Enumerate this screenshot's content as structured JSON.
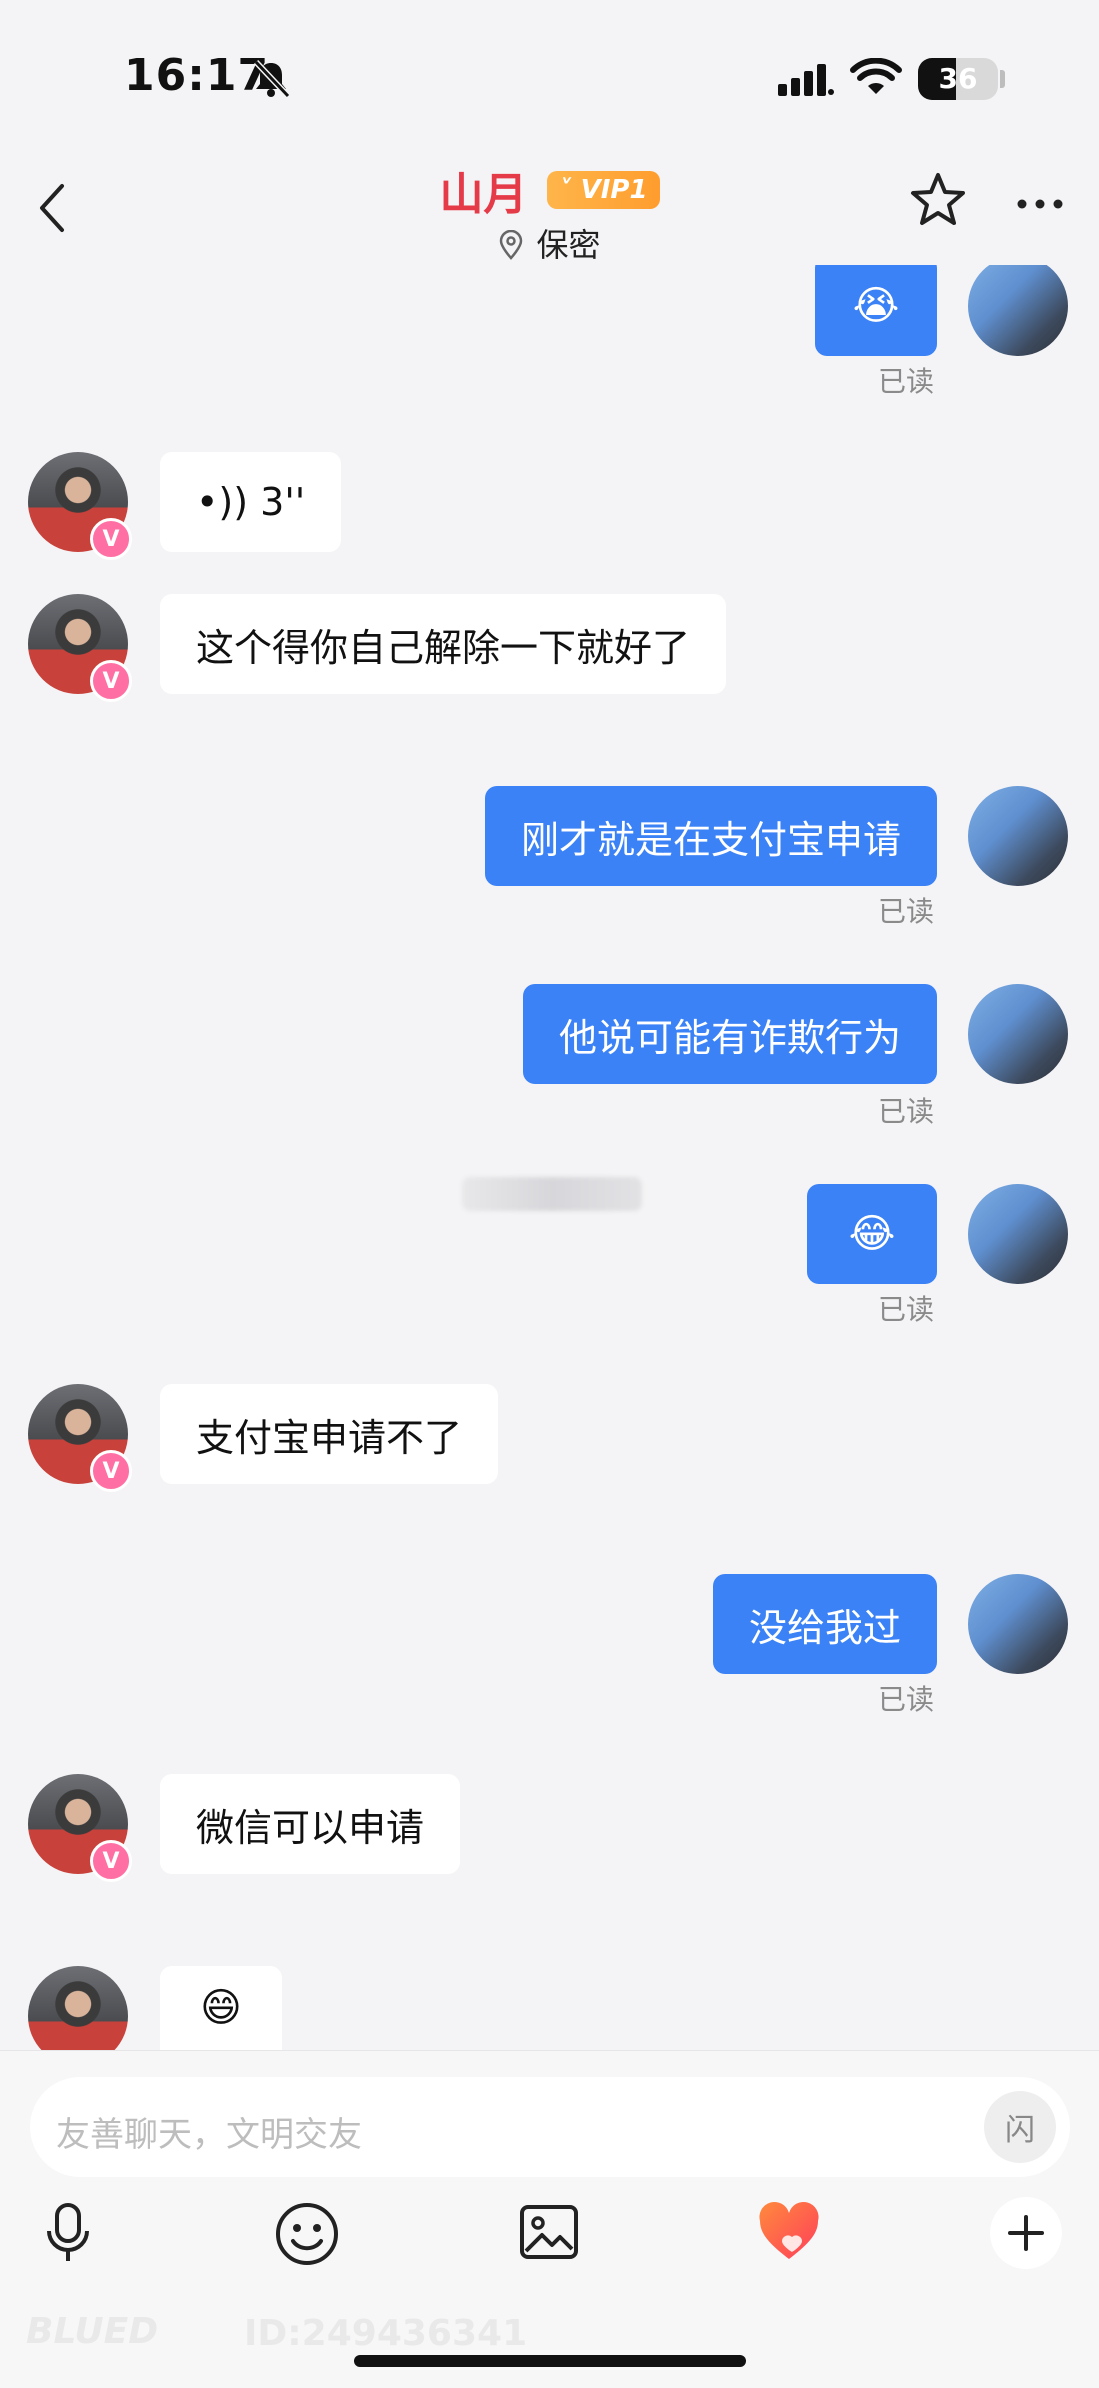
{
  "status": {
    "time": "16:17",
    "battery": "36"
  },
  "header": {
    "name": "山月",
    "vip": "VIP1",
    "location": "保密"
  },
  "messages": [
    {
      "side": "out",
      "type": "emoji",
      "text": "😭",
      "read": "已读"
    },
    {
      "side": "in",
      "type": "voice",
      "text": "•)) 3''"
    },
    {
      "side": "in",
      "type": "text",
      "text": "这个得你自己解除一下就好了"
    },
    {
      "side": "out",
      "type": "text",
      "text": "刚才就是在支付宝申请",
      "read": "已读"
    },
    {
      "side": "out",
      "type": "text",
      "text": "他说可能有诈欺行为",
      "read": "已读"
    },
    {
      "side": "out",
      "type": "emoji",
      "text": "😂",
      "read": "已读"
    },
    {
      "side": "in",
      "type": "text",
      "text": "支付宝申请不了"
    },
    {
      "side": "out",
      "type": "text",
      "text": "没给我过",
      "read": "已读"
    },
    {
      "side": "in",
      "type": "text",
      "text": "微信可以申请"
    },
    {
      "side": "in",
      "type": "emoji",
      "text": "😄"
    }
  ],
  "composer": {
    "placeholder": "友善聊天，文明交友",
    "flash_label": "闪"
  },
  "watermark": {
    "brand": "BLUED",
    "id": "ID:249436341"
  },
  "badge": "V",
  "icons": [
    "back-icon",
    "location-pin-icon",
    "star-icon",
    "more-icon",
    "mic-icon",
    "emoji-icon",
    "image-icon",
    "heart-icon",
    "plus-icon"
  ]
}
